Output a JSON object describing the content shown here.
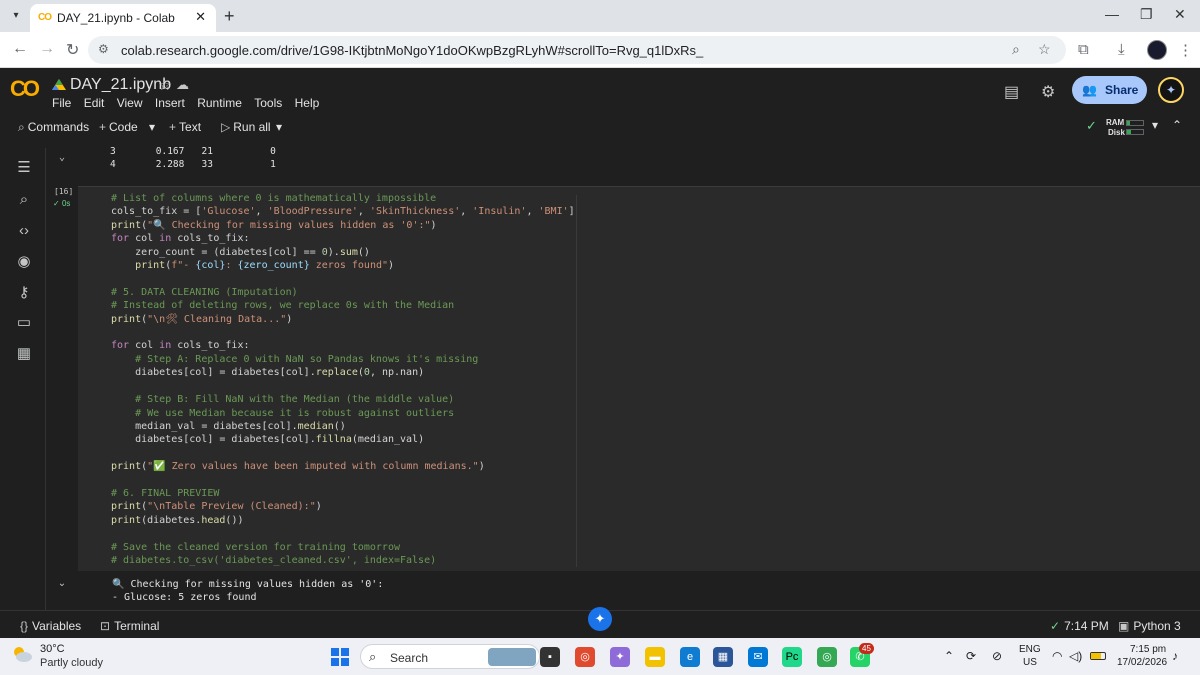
{
  "browser": {
    "tab_title": "DAY_21.ipynb - Colab",
    "url": "colab.research.google.com/drive/1G98-IKtjbtnMoNgoY1doOKwpBzgRLyhW#scrollTo=Rvg_q1lDxRs_"
  },
  "colab": {
    "logo": "CO",
    "notebook_title": "DAY_21.ipynb",
    "menu": [
      "File",
      "Edit",
      "View",
      "Insert",
      "Runtime",
      "Tools",
      "Help"
    ],
    "share_label": "Share",
    "toolbar": {
      "commands": "Commands",
      "code": "Code",
      "text": "Text",
      "run_all": "Run all"
    },
    "ram_label": "RAM",
    "disk_label": "Disk"
  },
  "prev_output": {
    "row1": "3       0.167   21          0",
    "row2": "4       2.288   33          1"
  },
  "cell": {
    "exec_count": "[16]",
    "exec_time": "0s"
  },
  "output": {
    "line1": "🔍 Checking for missing values hidden as '0':",
    "line2": "- Glucose: 5 zeros found"
  },
  "statusbar": {
    "variables": "Variables",
    "terminal": "Terminal",
    "time": "7:14 PM",
    "runtime": "Python 3"
  },
  "taskbar": {
    "temperature": "30°C",
    "weather": "Partly cloudy",
    "search": "Search",
    "badge": "45",
    "lang1": "ENG",
    "lang2": "US",
    "clock_time": "7:15 pm",
    "clock_date": "17/02/2026"
  },
  "colors": {
    "accent": "#a8c7fa",
    "colab_orange": "#f9ab00",
    "success_green": "#6dd58c"
  }
}
